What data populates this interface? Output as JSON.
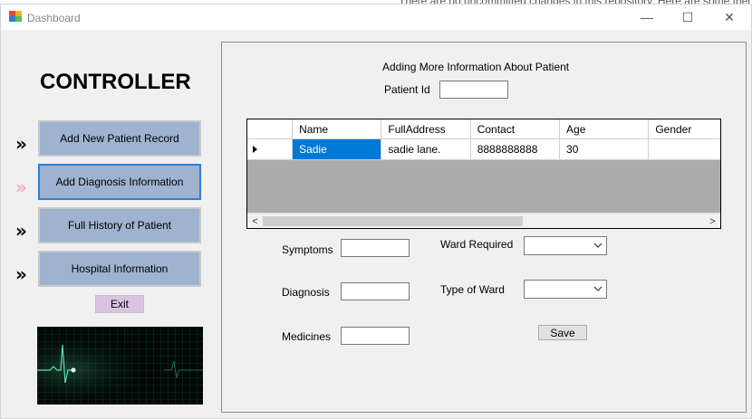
{
  "background": {
    "text": "There are no uncommitted changes in this repository. Here are some friend"
  },
  "window": {
    "title": "Dashboard",
    "minimize_glyph": "—",
    "maximize_glyph": "☐",
    "close_glyph": "✕"
  },
  "sidebar": {
    "title": "CONTROLLER",
    "chevron": "»",
    "items": [
      {
        "label": "Add New Patient Record"
      },
      {
        "label": "Add Diagnosis Information"
      },
      {
        "label": "Full History of Patient"
      },
      {
        "label": "Hospital Information"
      }
    ],
    "exit_label": "Exit"
  },
  "form": {
    "heading": "Adding More Information About Patient",
    "patient_id_label": "Patient Id",
    "patient_id_value": "",
    "symptoms_label": "Symptoms",
    "diagnosis_label": "Diagnosis",
    "medicines_label": "Medicines",
    "ward_required_label": "Ward Required",
    "type_of_ward_label": "Type of Ward",
    "ward_required_value": "",
    "type_of_ward_value": "",
    "save_label": "Save"
  },
  "grid": {
    "columns": [
      "Name",
      "FullAddress",
      "Contact",
      "Age",
      "Gender"
    ],
    "rows": [
      {
        "name": "Sadie",
        "address": "sadie lane.",
        "contact": "8888888888",
        "age": "30",
        "gender": ""
      }
    ]
  },
  "colors": {
    "nav_button": "#9db3cf",
    "active_chevron": "#f2a9b8",
    "selection": "#0078d7",
    "exit_button": "#d9c3e3"
  }
}
